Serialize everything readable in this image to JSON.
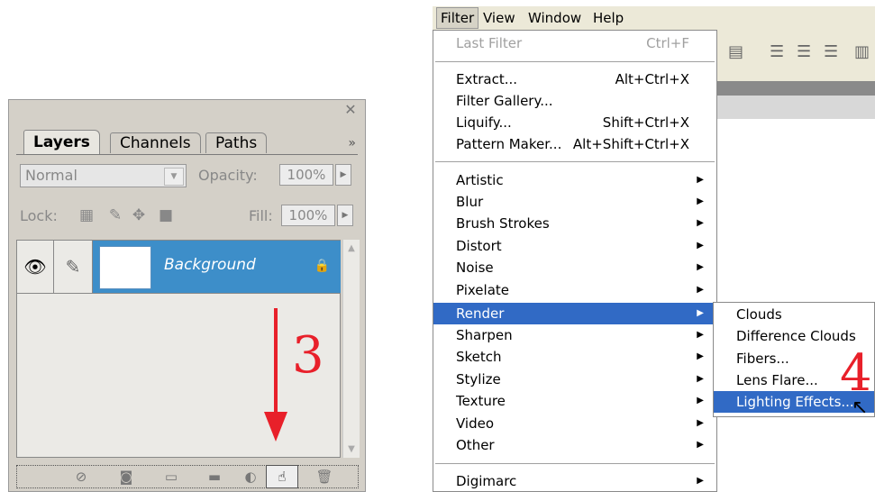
{
  "layers_panel": {
    "tabs": [
      "Layers",
      "Channels",
      "Paths"
    ],
    "blend_mode": "Normal",
    "opacity_label": "Opacity:",
    "opacity_value": "100%",
    "lock_label": "Lock:",
    "fill_label": "Fill:",
    "fill_value": "100%",
    "layer": {
      "name": "Background"
    },
    "annotation": "3"
  },
  "menubar": {
    "items": [
      "Filter",
      "View",
      "Window",
      "Help"
    ]
  },
  "filter_menu": {
    "last_filter": {
      "label": "Last Filter",
      "shortcut": "Ctrl+F"
    },
    "group1": [
      {
        "label": "Extract...",
        "shortcut": "Alt+Ctrl+X"
      },
      {
        "label": "Filter Gallery...",
        "shortcut": ""
      },
      {
        "label": "Liquify...",
        "shortcut": "Shift+Ctrl+X"
      },
      {
        "label": "Pattern Maker...",
        "shortcut": "Alt+Shift+Ctrl+X"
      }
    ],
    "group2": [
      "Artistic",
      "Blur",
      "Brush Strokes",
      "Distort",
      "Noise",
      "Pixelate",
      "Render",
      "Sharpen",
      "Sketch",
      "Stylize",
      "Texture",
      "Video",
      "Other"
    ],
    "highlighted": "Render",
    "group3": [
      "Digimarc"
    ]
  },
  "render_submenu": {
    "items": [
      "Clouds",
      "Difference Clouds",
      "Fibers...",
      "Lens Flare...",
      "Lighting Effects..."
    ],
    "highlighted": "Lighting Effects..."
  },
  "annotation_menu": "4",
  "colors": {
    "highlight": "#316ac5",
    "layer_selected": "#3d8ec9",
    "annotation": "#e8202a"
  }
}
